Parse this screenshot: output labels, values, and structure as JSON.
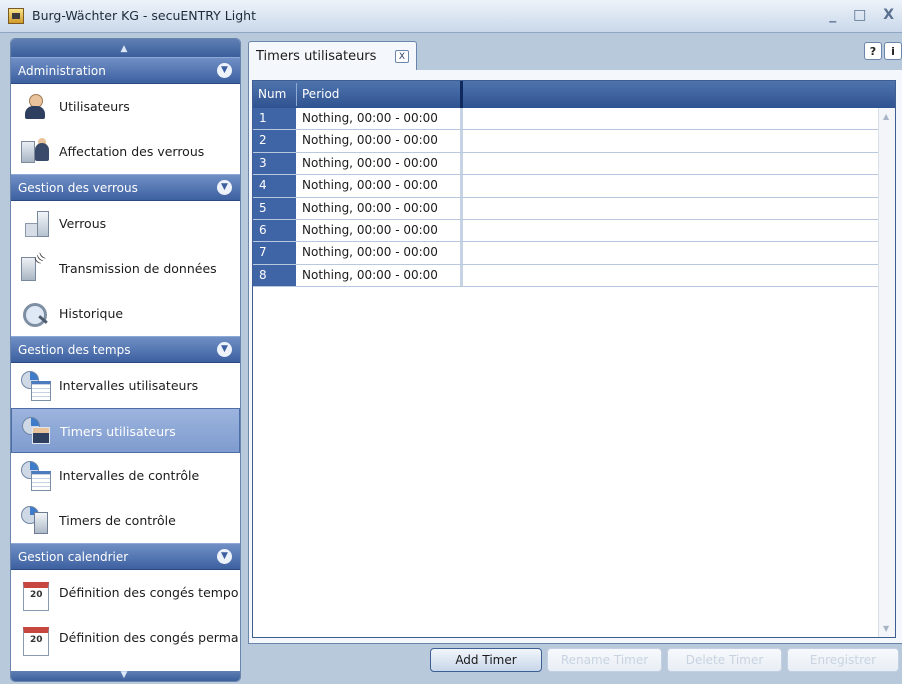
{
  "window": {
    "title": "Burg-Wächter KG - secuENTRY Light",
    "controls": "_ □ X"
  },
  "sidebar": {
    "sections": [
      {
        "label": "Administration",
        "items": [
          {
            "label": "Utilisateurs",
            "icon": "user-icon"
          },
          {
            "label": "Affectation des verrous",
            "icon": "lock-assign-icon"
          }
        ]
      },
      {
        "label": "Gestion des verrous",
        "items": [
          {
            "label": "Verrous",
            "icon": "lock-icon"
          },
          {
            "label": "Transmission de données",
            "icon": "transmission-icon"
          },
          {
            "label": "Historique",
            "icon": "history-icon"
          }
        ]
      },
      {
        "label": "Gestion des temps",
        "items": [
          {
            "label": "Intervalles utilisateurs",
            "icon": "user-intervals-icon"
          },
          {
            "label": "Timers utilisateurs",
            "icon": "user-timers-icon",
            "selected": true
          },
          {
            "label": "Intervalles de contrôle",
            "icon": "control-intervals-icon"
          },
          {
            "label": "Timers de contrôle",
            "icon": "control-timers-icon"
          }
        ]
      },
      {
        "label": "Gestion calendrier",
        "items": [
          {
            "label": "Définition des congés tempo",
            "icon": "holiday-temp-icon"
          },
          {
            "label": "Définition des congés perma",
            "icon": "holiday-perm-icon"
          }
        ]
      }
    ]
  },
  "tab": {
    "label": "Timers utilisateurs",
    "close": "X"
  },
  "help": {
    "help_label": "?",
    "info_label": "i"
  },
  "grid": {
    "columns": [
      "Num",
      "Period"
    ],
    "rows": [
      {
        "num": "1",
        "period": "Nothing, 00:00 - 00:00"
      },
      {
        "num": "2",
        "period": "Nothing, 00:00 - 00:00"
      },
      {
        "num": "3",
        "period": "Nothing, 00:00 - 00:00"
      },
      {
        "num": "4",
        "period": "Nothing, 00:00 - 00:00"
      },
      {
        "num": "5",
        "period": "Nothing, 00:00 - 00:00"
      },
      {
        "num": "6",
        "period": "Nothing, 00:00 - 00:00"
      },
      {
        "num": "7",
        "period": "Nothing, 00:00 - 00:00"
      },
      {
        "num": "8",
        "period": "Nothing, 00:00 - 00:00"
      }
    ]
  },
  "buttons": {
    "add": "Add Timer",
    "rename": "Rename Timer",
    "delete": "Delete Timer",
    "save": "Enregistrer"
  },
  "colors": {
    "accent": "#3d60a0",
    "selected": "#8aa4d3",
    "row_number": "#3f65a6"
  }
}
